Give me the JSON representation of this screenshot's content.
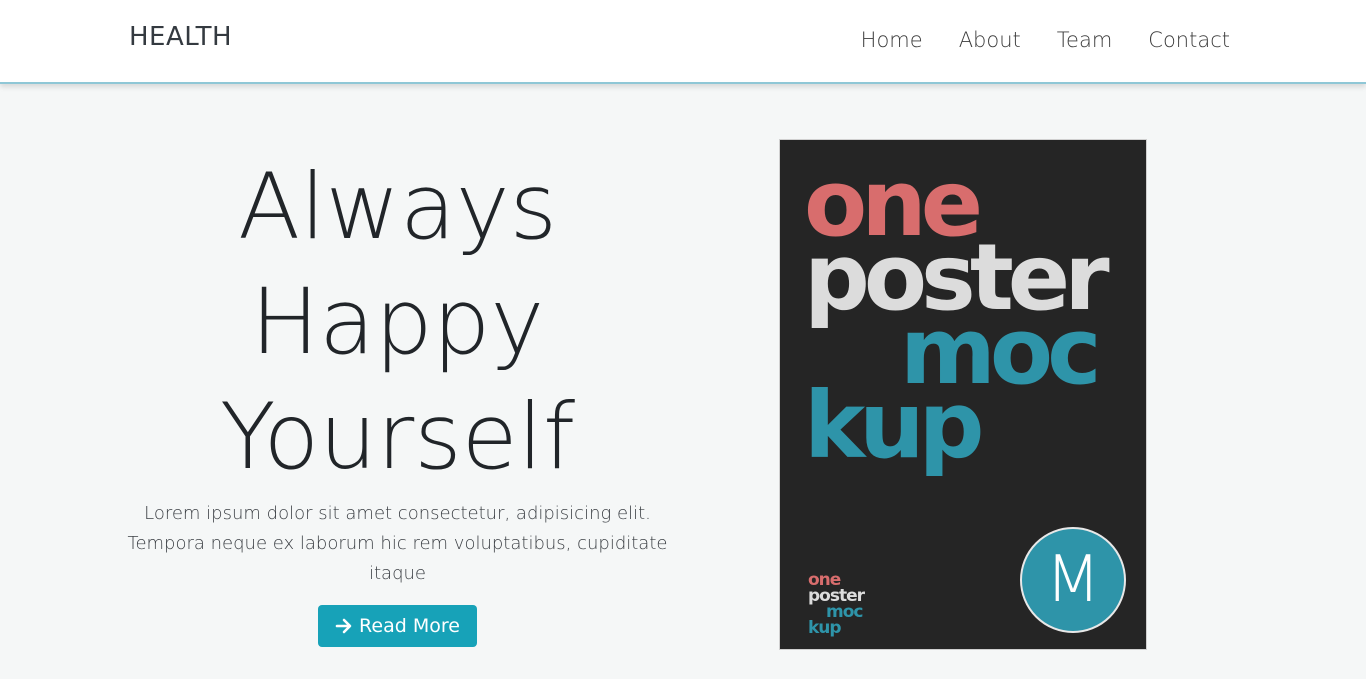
{
  "navbar": {
    "brand": "HEALTH",
    "links": [
      "Home",
      "About",
      "Team",
      "Contact"
    ]
  },
  "hero": {
    "title_lines": [
      "Always",
      "Happy",
      "Yourself"
    ],
    "text": "Lorem ipsum dolor sit amet consectetur, adipisicing elit. Tempora neque ex laborum hic rem voluptatibus, cupiditate itaque",
    "button_label": "Read More",
    "button_icon": "arrow-right-icon"
  },
  "poster": {
    "words": [
      "one",
      "poster",
      "moc",
      "kup"
    ],
    "small_words": [
      "one",
      "poster",
      "moc",
      "kup"
    ],
    "badge_letter": "M"
  },
  "colors": {
    "accent": "#17a2b8",
    "poster_bg": "#252525",
    "poster_red": "#d86d6d",
    "poster_light": "#dcdcdc",
    "poster_teal": "#2e94a9"
  }
}
